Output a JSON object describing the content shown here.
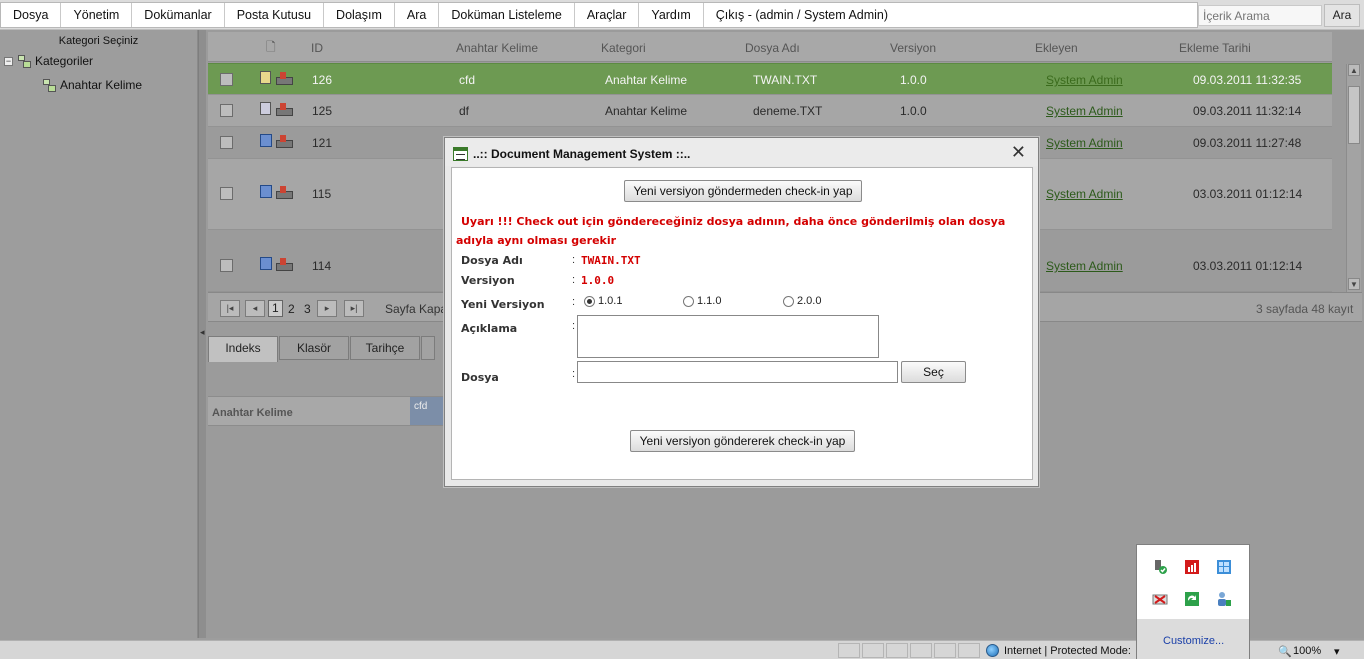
{
  "menu": {
    "items": [
      "Dosya",
      "Yönetim",
      "Dokümanlar",
      "Posta Kutusu",
      "Dolaşım",
      "Ara",
      "Doküman Listeleme",
      "Araçlar",
      "Yardım",
      "Çıkış - (admin / System Admin)"
    ],
    "search_placeholder": "İçerik Arama",
    "search_button": "Ara"
  },
  "left_panel": {
    "title": "Kategori Seçiniz",
    "root": "Kategoriler",
    "child": "Anahtar Kelime"
  },
  "grid": {
    "columns": [
      "ID",
      "Anahtar Kelime",
      "Kategori",
      "Dosya Adı",
      "Versiyon",
      "Ekleyen",
      "Ekleme Tarihi"
    ],
    "rows": [
      {
        "id": "126",
        "keyword": "cfd",
        "category": "Anahtar Kelime",
        "file": "TWAIN.TXT",
        "version": "1.0.0",
        "user": "System Admin",
        "date": "09.03.2011 11:32:35"
      },
      {
        "id": "125",
        "keyword": "df",
        "category": "Anahtar Kelime",
        "file": "deneme.TXT",
        "version": "1.0.0",
        "user": "System Admin",
        "date": "09.03.2011 11:32:14"
      },
      {
        "id": "121",
        "keyword": "",
        "category": "",
        "file": "",
        "version": "",
        "user": "System Admin",
        "date": "09.03.2011 11:27:48"
      },
      {
        "id": "115",
        "keyword": "",
        "category": "",
        "file": "",
        "version": "",
        "user": "System Admin",
        "date": "03.03.2011 01:12:14"
      },
      {
        "id": "114",
        "keyword": "",
        "category": "",
        "file": "",
        "version": "",
        "user": "System Admin",
        "date": "03.03.2011 01:12:14"
      }
    ]
  },
  "pager": {
    "pages": [
      "1",
      "2",
      "3"
    ],
    "page_size_label": "Sayfa Kapa:",
    "summary": "3 sayfada 48 kayıt"
  },
  "tabs": [
    "Indeks",
    "Klasör",
    "Tarihçe"
  ],
  "index_tab": {
    "column": "Anahtar Kelime",
    "value": "cfd"
  },
  "modal": {
    "title": "..:: Document Management System ::..",
    "top_button": "Yeni versiyon göndermeden check-in yap",
    "warning": "Uyarı !!! Check out için göndereceğiniz dosya adının, daha önce gönderilmiş olan dosya adıyla aynı olması gerekir",
    "labels": {
      "file_name": "Dosya Adı",
      "version": "Versiyon",
      "new_version": "Yeni Versiyon",
      "description": "Açıklama",
      "file": "Dosya"
    },
    "colon": ":",
    "file_name_value": "TWAIN.TXT",
    "version_value": "1.0.0",
    "new_version_options": [
      "1.0.1",
      "1.1.0",
      "2.0.0"
    ],
    "selected_version": "1.0.1",
    "browse_button": "Seç",
    "bottom_button": "Yeni versiyon göndererek check-in yap"
  },
  "statusbar": {
    "zone": "Internet | Protected Mode:",
    "zoom": "100%"
  },
  "tray": {
    "customize": "Customize..."
  }
}
